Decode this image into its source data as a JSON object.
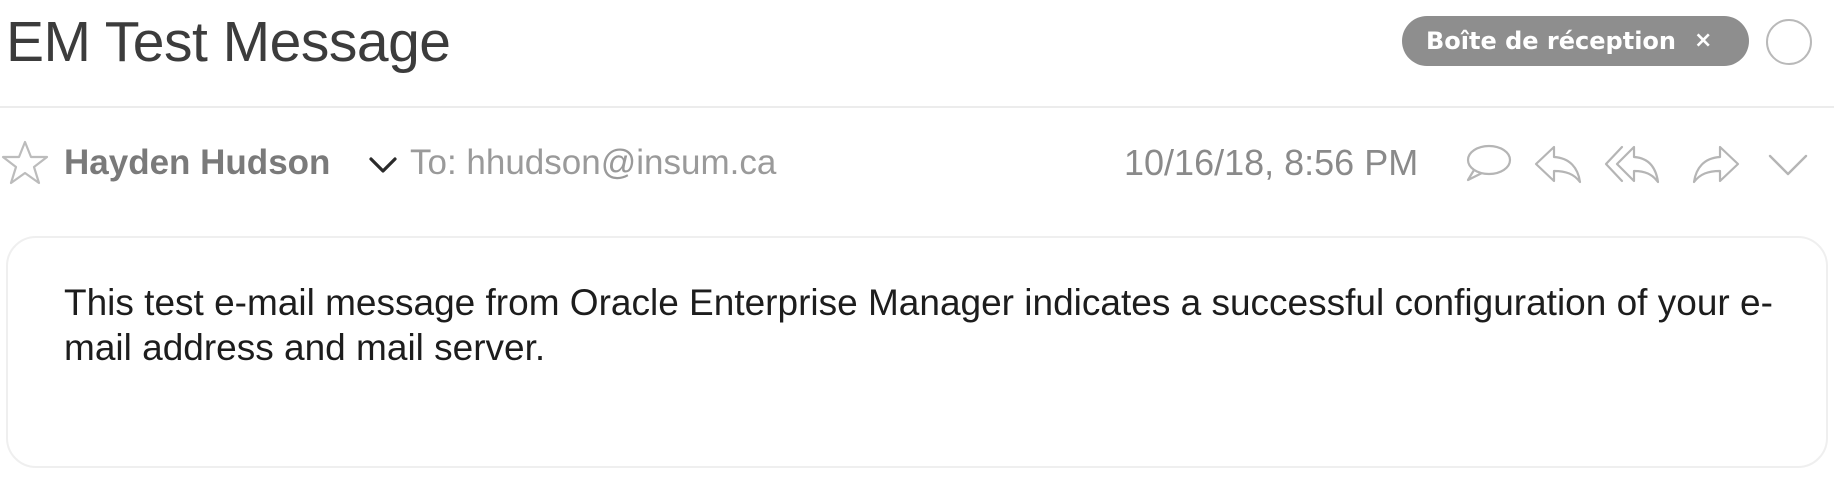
{
  "message": {
    "subject": "EM Test Message",
    "mailbox_tag": "Boîte de réception",
    "mailbox_tag_close": "×",
    "sender_name": "Hayden Hudson",
    "to_line": "To: hhudson@insum.ca",
    "date": "10/16/18, 8:56 PM",
    "body": "This test e-mail message from Oracle Enterprise Manager indicates a successful configuration of your e-mail address and mail server."
  },
  "icons": {
    "star": "star-outline-icon",
    "sender_menu": "chevron-down-icon",
    "status": "circle-icon",
    "actions": [
      "comment-icon",
      "reply-icon",
      "reply-all-icon",
      "forward-icon",
      "chevron-down-icon"
    ]
  },
  "colors": {
    "tag_background": "#8e8e8e",
    "icon_gray": "#b5b5b5",
    "text_dark": "#1d1d1d",
    "subject_text": "#3c3c3c"
  }
}
